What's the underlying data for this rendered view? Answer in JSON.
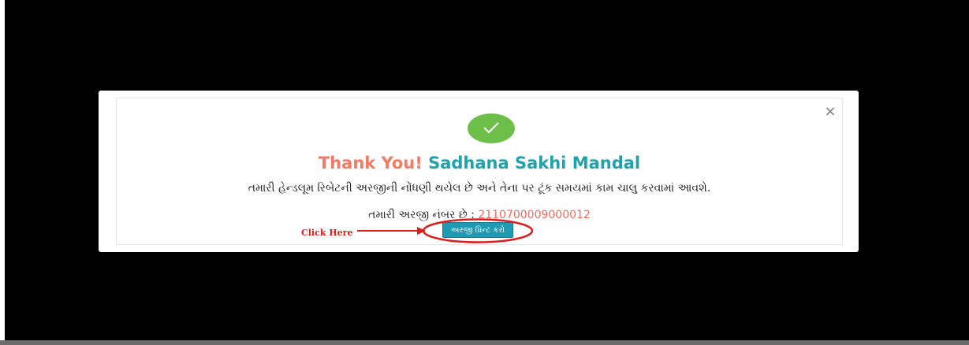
{
  "modal": {
    "close_symbol": "×",
    "success_icon": "check-icon",
    "title_prefix": "Thank You!",
    "title_name": "Sadhana Sakhi Mandal",
    "message": "તમારી હેન્ડલૂમ રિબેટની અરજીની નોંધણી થયેલ છે અને તેના પર ટૂંક સમયમાં કામ ચાલુ કરવામાં આવશે.",
    "application_label": "તમારી અરજી નંબર છે :",
    "application_number": "2110700009000012",
    "print_button_label": "અરજી પ્રિન્ટ કરો"
  },
  "annotation": {
    "click_here": "Click Here"
  },
  "colors": {
    "overlay": "#000000",
    "title_prefix": "#f27b64",
    "title_name": "#1fa2ad",
    "success": "#6cc04a",
    "button": "#1f9ab3",
    "annotation": "#e01b1b"
  }
}
